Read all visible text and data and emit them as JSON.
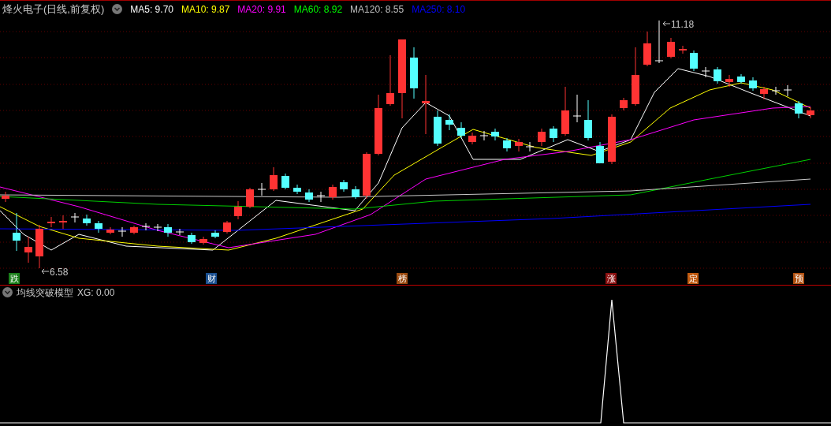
{
  "header": {
    "title": "烽火电子(日线,前复权)",
    "indicators": [
      {
        "label": "MA5: 9.70",
        "color": "#ffffff"
      },
      {
        "label": "MA10: 9.87",
        "color": "#ffff00"
      },
      {
        "label": "MA20: 9.91",
        "color": "#ff00ff"
      },
      {
        "label": "MA60: 8.92",
        "color": "#00ff00"
      },
      {
        "label": "MA120: 8.55",
        "color": "#c0c0c0"
      },
      {
        "label": "MA250: 8.10",
        "color": "#0000ff"
      }
    ]
  },
  "chart": {
    "high_label": "11.18",
    "low_label": "6.58",
    "markers": [
      {
        "text": "跌",
        "color": "#1b7f1b"
      },
      {
        "text": "财",
        "color": "#1a4f8f"
      },
      {
        "text": "榜",
        "color": "#9a4a10"
      },
      {
        "text": "涨",
        "color": "#8a1010"
      },
      {
        "text": "定",
        "color": "#c05a10"
      },
      {
        "text": "预",
        "color": "#b05010"
      }
    ]
  },
  "indicator_panel": {
    "title": "均线突破模型",
    "reading": "XG: 0.00"
  }
}
